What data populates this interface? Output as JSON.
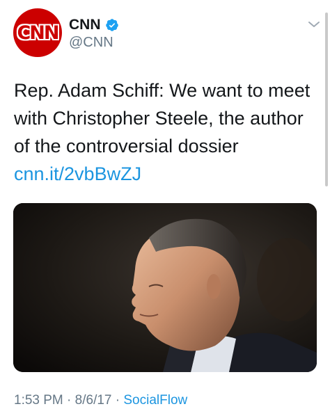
{
  "author": {
    "display_name": "CNN",
    "handle": "@CNN",
    "avatar_logo": "CNN",
    "verified": true
  },
  "tweet": {
    "text": "Rep. Adam Schiff: We want to meet with Christopher Steele, the author of the controversial dossier ",
    "link": "cnn.it/2vbBwZJ"
  },
  "meta": {
    "time": "1:53 PM",
    "separator1": " · ",
    "date": "8/6/17",
    "separator2": " · ",
    "source": "SocialFlow"
  },
  "colors": {
    "brand_red": "#cc0000",
    "link_blue": "#1b95e0",
    "secondary_gray": "#657786",
    "verified_blue": "#1da1f2"
  },
  "icons": {
    "verified": "verified-badge-icon",
    "menu": "chevron-down-icon"
  }
}
